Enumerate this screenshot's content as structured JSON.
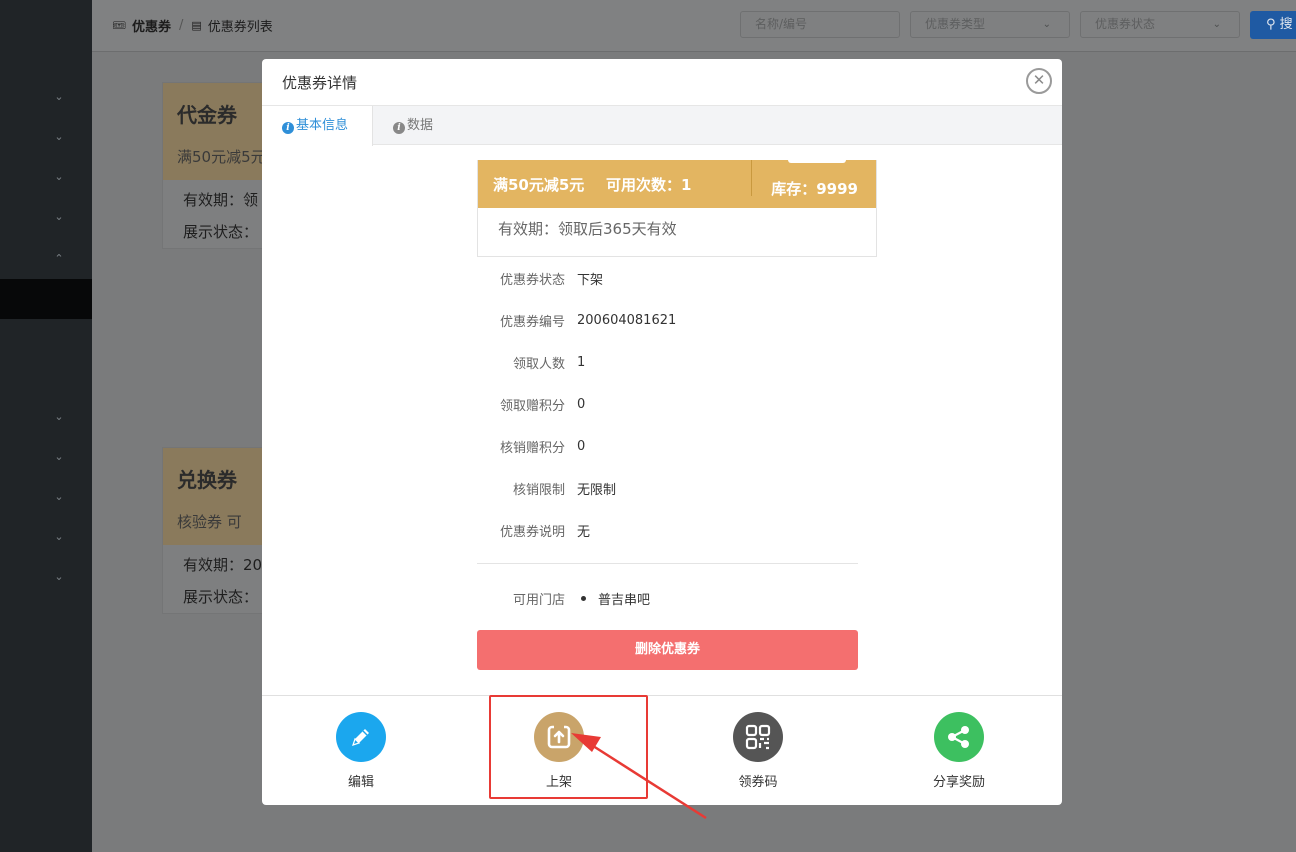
{
  "breadcrumb": {
    "root": "优惠券",
    "separator": "/",
    "current": "优惠券列表"
  },
  "filters": {
    "name_placeholder": "名称/编号",
    "type_placeholder": "优惠券类型",
    "status_placeholder": "优惠券状态",
    "search_label": "搜"
  },
  "background_cards": [
    {
      "title": "代金券",
      "subtitle": "满50元减5元",
      "validity": "有效期：领",
      "display": "展示状态："
    },
    {
      "title": "兑换券",
      "subtitle": "核验券  可",
      "validity": "有效期：20",
      "display": "展示状态："
    }
  ],
  "modal": {
    "title": "优惠券详情",
    "tabs": [
      {
        "label": "基本信息"
      },
      {
        "label": "数据"
      }
    ],
    "coupon": {
      "condition": "满50元减5元",
      "uses": "可用次数：1",
      "stock": "库存：9999",
      "validity": "有效期：领取后365天有效",
      "color": "#e3b561"
    },
    "details": [
      {
        "label": "优惠券状态",
        "value": "下架"
      },
      {
        "label": "优惠券编号",
        "value": "200604081621"
      },
      {
        "label": "领取人数",
        "value": "1"
      },
      {
        "label": "领取赠积分",
        "value": "0"
      },
      {
        "label": "核销赠积分",
        "value": "0"
      },
      {
        "label": "核销限制",
        "value": "无限制"
      },
      {
        "label": "优惠券说明",
        "value": "无"
      }
    ],
    "stores_label": "可用门店",
    "stores": [
      "普吉串吧"
    ],
    "delete_label": "删除优惠券",
    "actions": [
      {
        "label": "编辑",
        "icon": "pencil-icon",
        "color": "#1ba7ee"
      },
      {
        "label": "上架",
        "icon": "shelf-up-icon",
        "color": "#c9a46a"
      },
      {
        "label": "领券码",
        "icon": "qr-code-icon",
        "color": "#555555"
      },
      {
        "label": "分享奖励",
        "icon": "share-icon",
        "color": "#3dc060"
      }
    ]
  },
  "annotation": {
    "color": "#e83a35"
  }
}
